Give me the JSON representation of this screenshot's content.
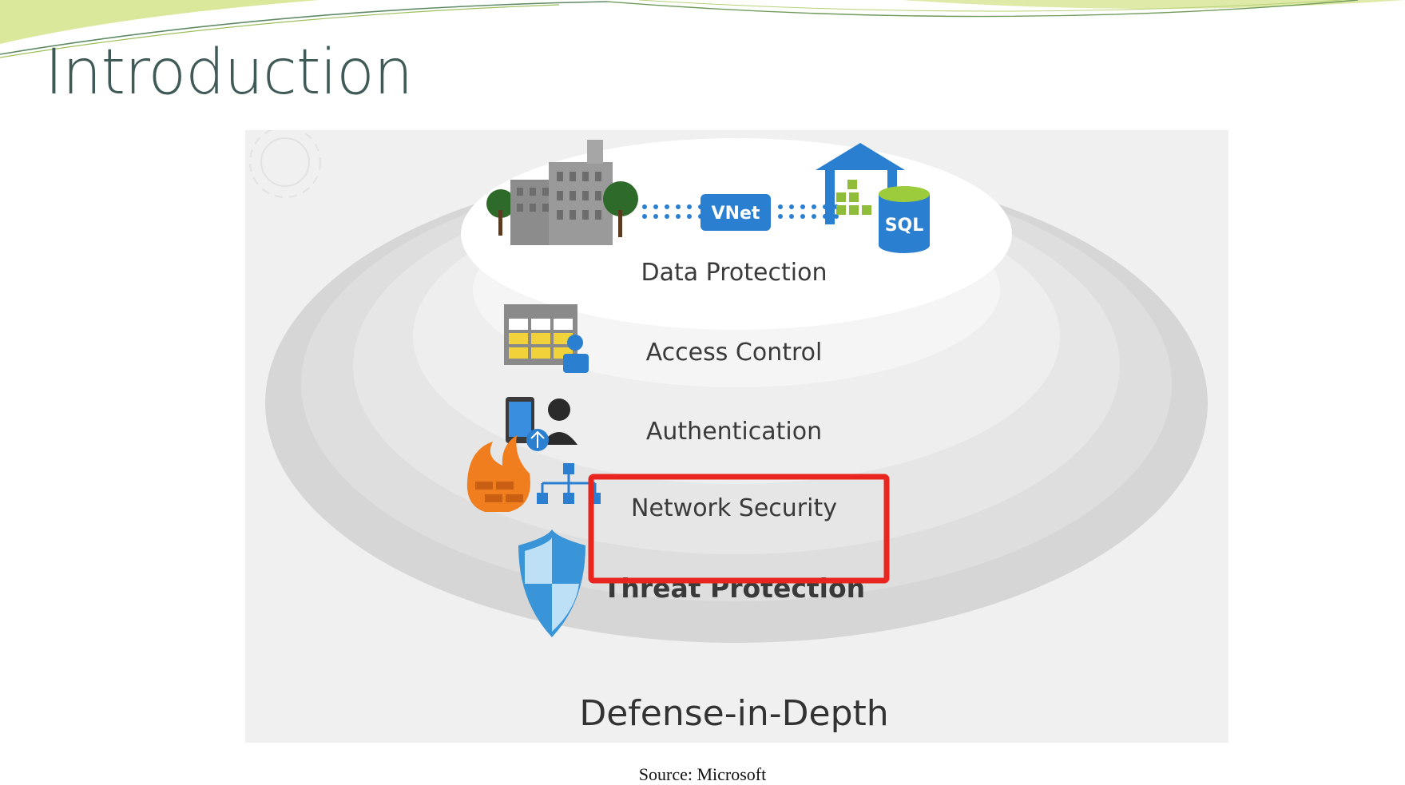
{
  "slide": {
    "title": "Introduction",
    "source_caption": "Source: Microsoft"
  },
  "diagram": {
    "vnet_label": "VNet",
    "sql_label": "SQL",
    "layers": [
      {
        "label": "Data Protection",
        "icon": "building-vnet-sql-icon"
      },
      {
        "label": "Access Control",
        "icon": "access-table-user-icon"
      },
      {
        "label": "Authentication",
        "icon": "phone-user-icon"
      },
      {
        "label": "Network Security",
        "icon": "firewall-network-icon",
        "highlighted": true
      },
      {
        "label": "Threat Protection",
        "icon": "shield-icon"
      }
    ],
    "bottom_label": "Defense-in-Depth"
  },
  "colors": {
    "title_text": "#3f5a57",
    "highlight_box": "#e8261f",
    "accent_blue": "#2b7fd0",
    "accent_green": "#9ccc3c",
    "swoosh_green": "#c5dc6e"
  }
}
